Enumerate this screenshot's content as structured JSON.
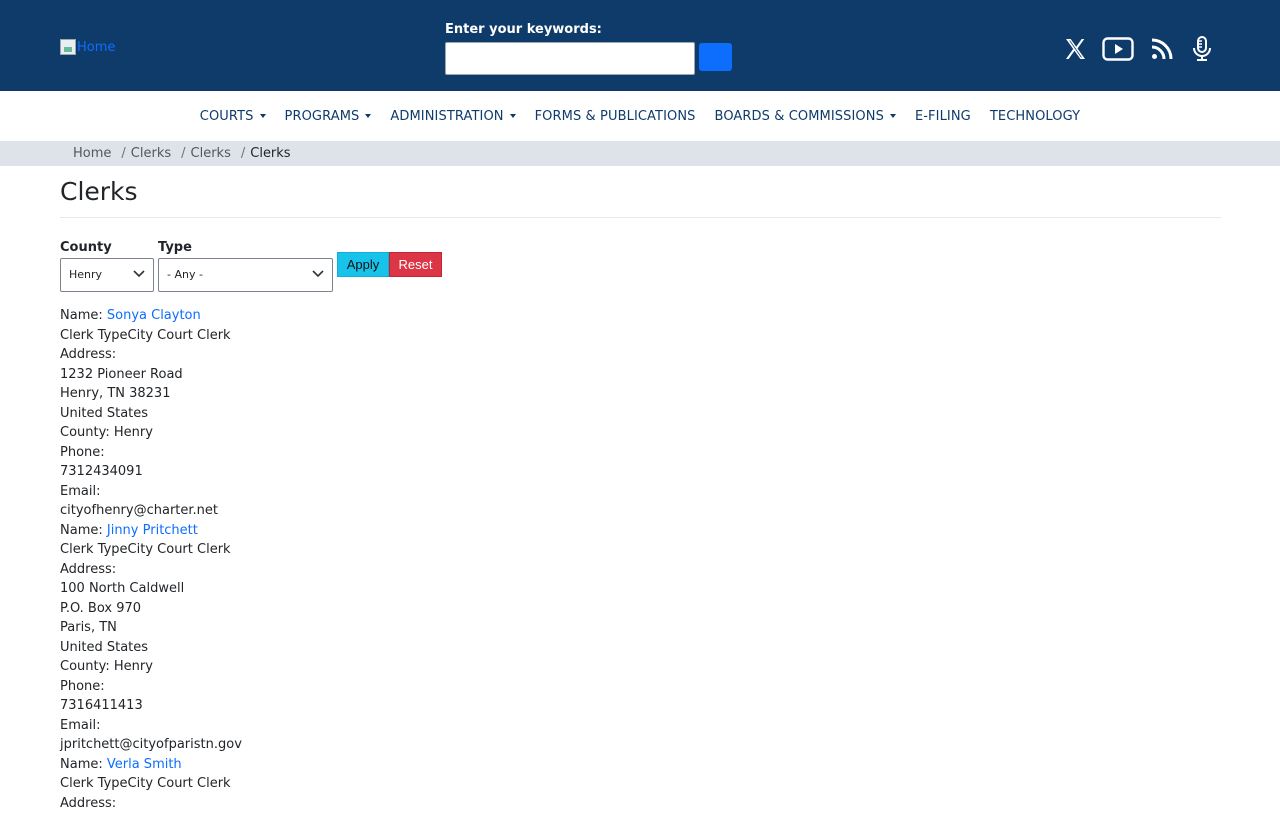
{
  "header": {
    "logo_alt": "Home",
    "search_label": "Enter your keywords:",
    "search_value": "",
    "social": [
      "x-icon",
      "youtube-icon",
      "rss-icon",
      "podcast-icon"
    ]
  },
  "nav": [
    {
      "label": "COURTS",
      "dropdown": true
    },
    {
      "label": "PROGRAMS",
      "dropdown": true
    },
    {
      "label": "ADMINISTRATION",
      "dropdown": true
    },
    {
      "label": "FORMS & PUBLICATIONS",
      "dropdown": false
    },
    {
      "label": "BOARDS & COMMISSIONS",
      "dropdown": true
    },
    {
      "label": "E-FILING",
      "dropdown": false
    },
    {
      "label": "TECHNOLOGY",
      "dropdown": false
    }
  ],
  "breadcrumb": [
    "Home",
    "Clerks",
    "Clerks",
    "Clerks"
  ],
  "page_title": "Clerks",
  "filters": {
    "county_label": "County",
    "county_value": "Henry",
    "type_label": "Type",
    "type_value": "- Any -",
    "apply_label": "Apply",
    "reset_label": "Reset"
  },
  "labels": {
    "name": "Name: ",
    "clerk_type": "Clerk Type",
    "address": "Address:",
    "county": "County: ",
    "phone": "Phone:",
    "email": "Email:"
  },
  "clerks": [
    {
      "name": "Sonya Clayton",
      "type": "City Court Clerk",
      "address": [
        "1232 Pioneer Road",
        "Henry, TN 38231",
        "United States"
      ],
      "county": "Henry",
      "phone": "7312434091",
      "email": "cityofhenry@charter.net"
    },
    {
      "name": "Jinny Pritchett",
      "type": "City Court Clerk",
      "address": [
        "100 North Caldwell",
        "P.O. Box 970",
        "Paris, TN",
        "United States"
      ],
      "county": "Henry",
      "phone": "7316411413",
      "email": "jpritchett@cityofparistn.gov"
    },
    {
      "name": "Verla Smith",
      "type": "City Court Clerk",
      "address": [
        "Address:"
      ],
      "county": "",
      "phone": "",
      "email": ""
    }
  ],
  "colors": {
    "header_bg": "#0f3b6b",
    "link": "#0d6efd",
    "apply_bg": "#17c3ea",
    "reset_bg": "#dc3545",
    "breadcrumb_bg": "#dde3e8"
  }
}
